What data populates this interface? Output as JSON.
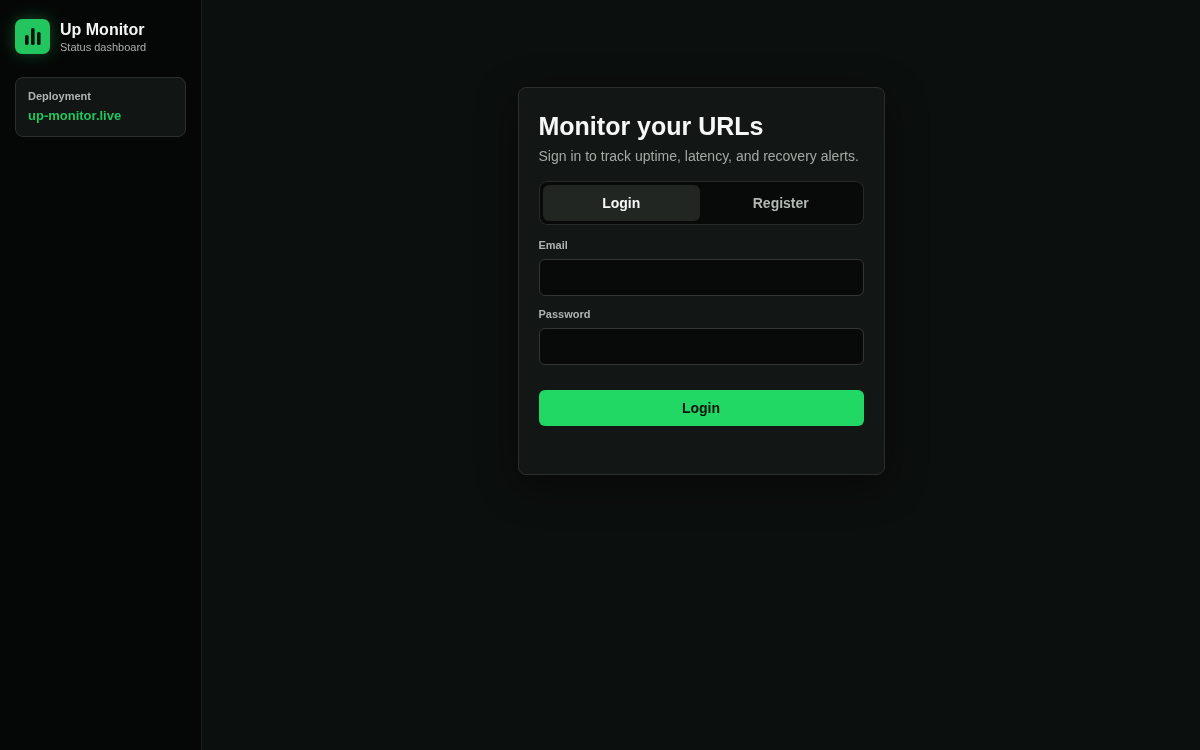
{
  "sidebar": {
    "brand": {
      "title": "Up Monitor",
      "subtitle": "Status dashboard"
    },
    "deployment": {
      "label": "Deployment",
      "value": "up-monitor.live"
    }
  },
  "login_card": {
    "title": "Monitor your URLs",
    "subtitle": "Sign in to track uptime, latency, and recovery alerts.",
    "tabs": [
      {
        "label": "Login",
        "selected": true
      },
      {
        "label": "Register",
        "selected": false
      }
    ],
    "fields": [
      {
        "label": "Email"
      },
      {
        "label": "Password"
      }
    ],
    "submit": "Login"
  }
}
